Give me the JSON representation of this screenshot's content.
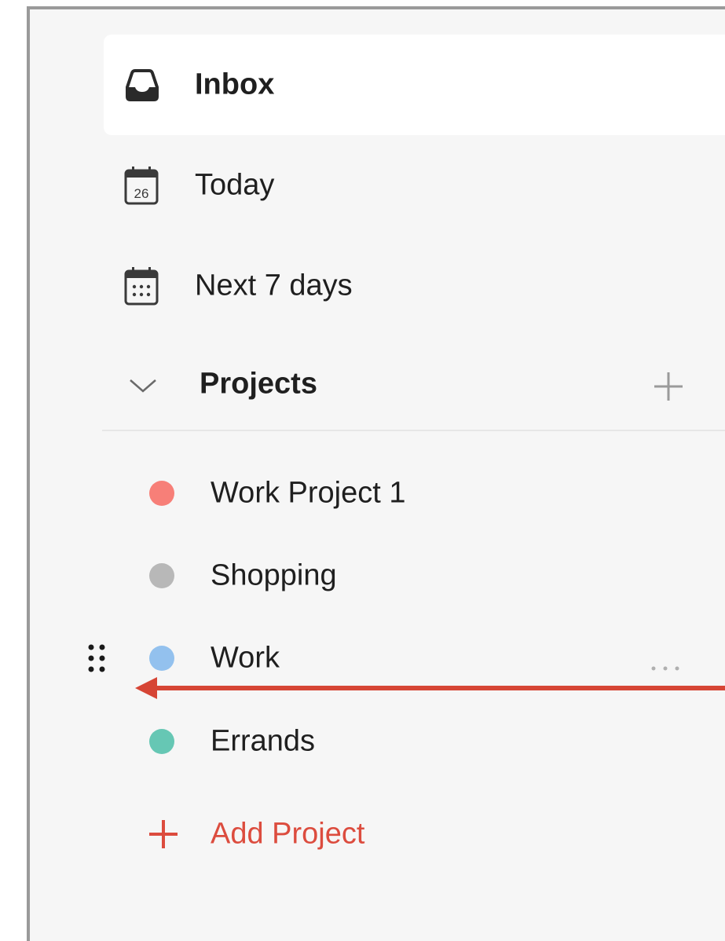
{
  "nav": {
    "inbox": {
      "label": "Inbox"
    },
    "today": {
      "label": "Today",
      "date_number": "26"
    },
    "next7": {
      "label": "Next 7 days"
    }
  },
  "projects": {
    "header_label": "Projects",
    "items": [
      {
        "label": "Work Project 1",
        "color": "#f77f78"
      },
      {
        "label": "Shopping",
        "color": "#b8b8b8"
      },
      {
        "label": "Work",
        "color": "#93c1ee"
      },
      {
        "label": "Errands",
        "color": "#66c7b4"
      }
    ],
    "add_label": "Add Project"
  },
  "colors": {
    "accent": "#dc4c3e",
    "annotation_arrow": "#d64535"
  },
  "icons": [
    "inbox-icon",
    "calendar-today-icon",
    "calendar-week-icon",
    "chevron-down-icon",
    "plus-icon",
    "drag-handle-icon",
    "more-horizontal-icon"
  ]
}
